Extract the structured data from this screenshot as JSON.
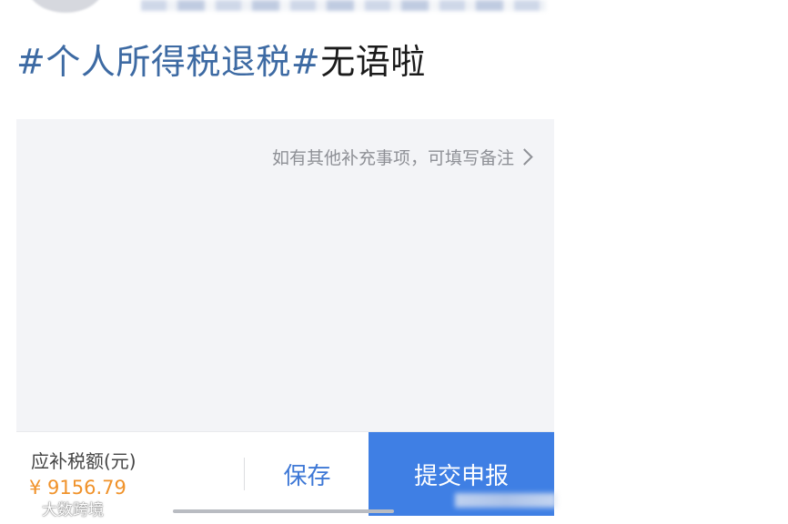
{
  "post": {
    "hashtag": "#个人所得税退税#",
    "text": "无语啦"
  },
  "panel": {
    "remark_link": "如有其他补充事项，可填写备注"
  },
  "bottom_bar": {
    "amount_label": "应补税额(元)",
    "amount_value": "¥ 9156.79",
    "save_label": "保存",
    "submit_label": "提交申报"
  },
  "watermark": {
    "text": "大数跨境"
  },
  "colors": {
    "hashtag": "#3d6aa3",
    "accent": "#3f7fe4",
    "amount": "#f0922a"
  },
  "icons": [
    "chevron-right-icon",
    "watermark-logo-icon"
  ]
}
